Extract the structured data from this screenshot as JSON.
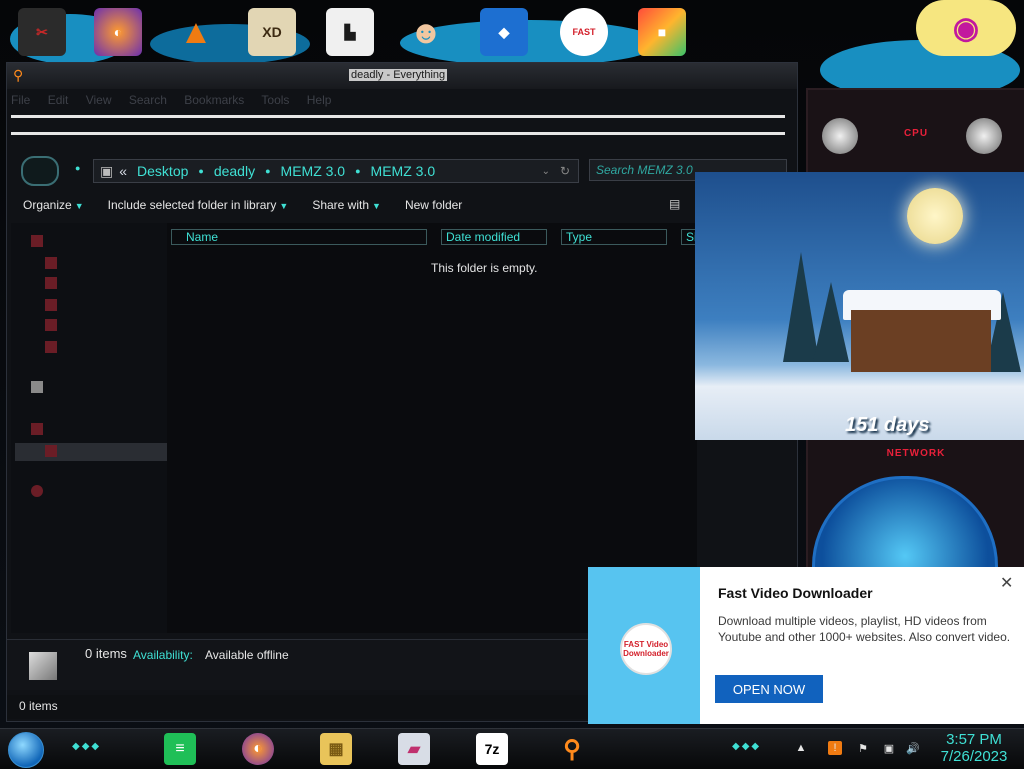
{
  "window": {
    "title": "deadly - Everything",
    "menu": [
      "File",
      "Edit",
      "View",
      "Search",
      "Bookmarks",
      "Tools",
      "Help"
    ],
    "address": {
      "overflow": "«",
      "crumbs": [
        "Desktop",
        "deadly",
        "MEMZ 3.0",
        "MEMZ 3.0"
      ]
    },
    "search_placeholder": "Search MEMZ 3.0",
    "commands": {
      "organize": "Organize",
      "include_library": "Include selected folder in library",
      "share_with": "Share with",
      "new_folder": "New folder"
    },
    "columns": {
      "name": "Name",
      "date_modified": "Date modified",
      "type": "Type",
      "size": "Si"
    },
    "empty_message": "This folder is empty.",
    "details": {
      "count": "0 items",
      "availability_label": "Availability:",
      "availability_value": "Available offline"
    },
    "status": "0 items"
  },
  "countdown": {
    "text": "151 days"
  },
  "gadget": {
    "top_label": "CPU",
    "network_label": "NETWORK"
  },
  "notification": {
    "title": "Fast Video Downloader",
    "body": "Download multiple videos, playlist, HD videos from Youtube and other 1000+ websites. Also convert video.",
    "button": "OPEN NOW",
    "close": "✕",
    "logo_text": "FAST Video Downloader"
  },
  "desktop_icons": [
    "settings-icon",
    "firefox-icon",
    "vlc-icon",
    "xd-icon",
    "game-icon",
    "doctor-icon",
    "shield-icon",
    "fast-video-downloader-icon",
    "office-icon"
  ],
  "taskbar": {
    "apps": [
      "notes-icon",
      "firefox-icon",
      "file-explorer-icon",
      "image-viewer-icon",
      "7zip-icon",
      "search-everything-icon"
    ],
    "seven_zip_label": "7z",
    "clock_time": "3:57 PM",
    "clock_date": "7/26/2023"
  },
  "colors": {
    "accent": "#3fe0d4",
    "notification_blue": "#1162be"
  }
}
